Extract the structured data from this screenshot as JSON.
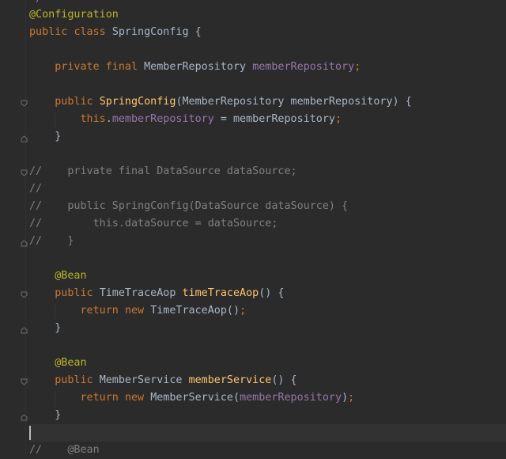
{
  "code": {
    "top": "*/",
    "l1_annotation": "@Configuration",
    "l2_public": "public",
    "l2_class": "class",
    "l2_name": "SpringConfig {",
    "l3_private": "private",
    "l3_final": "final",
    "l3_type": "MemberRepository",
    "l3_field": "memberRepository",
    "l3_semi": ";",
    "l4_public": "public",
    "l4_ctor": "SpringConfig",
    "l4_params": "(MemberRepository memberRepository) {",
    "l5_this": "this",
    "l5_dot": ".",
    "l5_field": "memberRepository",
    "l5_assign": " = memberRepository",
    "l5_semi": ";",
    "l6_close": "}",
    "c1": "//    private final DataSource dataSource;",
    "c2": "//",
    "c3": "//    public SpringConfig(DataSource dataSource) {",
    "c4": "//        this.dataSource = dataSource;",
    "c5": "//    }",
    "b1_annotation": "@Bean",
    "b1_public": "public",
    "b1_type": "TimeTraceAop",
    "b1_method": "timeTraceAop",
    "b1_paren": "() {",
    "b1_return": "return",
    "b1_new": "new",
    "b1_call": "TimeTraceAop()",
    "b1_semi": ";",
    "b1_close": "}",
    "b2_annotation": "@Bean",
    "b2_public": "public",
    "b2_type": "MemberService",
    "b2_method": "memberService",
    "b2_paren": "() {",
    "b2_return": "return",
    "b2_new": "new",
    "b2_call": "MemberService(",
    "b2_arg": "memberRepository",
    "b2_callclose": ")",
    "b2_semi": ";",
    "b2_close": "}",
    "last": "//    @Bean"
  },
  "colors": {
    "background": "#2b2b2b",
    "keyword": "#cc7832",
    "annotation": "#bbb529",
    "field": "#9876aa",
    "method": "#ffc66d",
    "comment": "#808080",
    "text": "#a9b7c6"
  },
  "icons": [
    "fold-icon"
  ]
}
